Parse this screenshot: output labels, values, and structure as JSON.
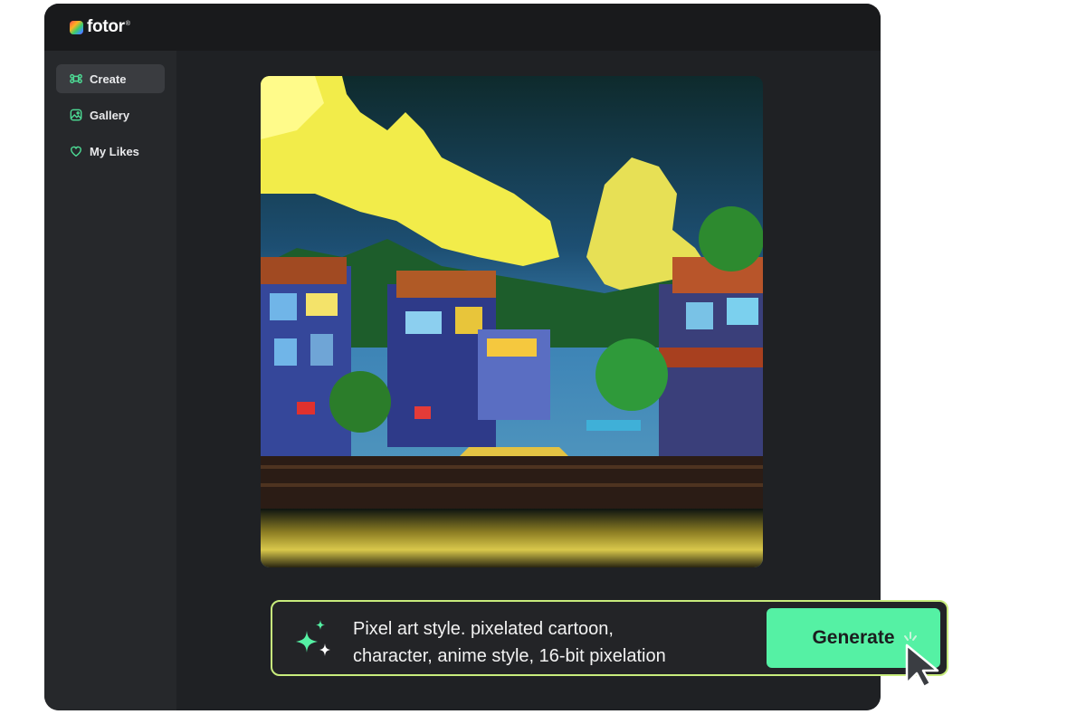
{
  "brand": {
    "name": "fotor",
    "mark": "®"
  },
  "sidebar": {
    "items": [
      {
        "label": "Create",
        "icon": "command-icon",
        "active": true
      },
      {
        "label": "Gallery",
        "icon": "image-icon",
        "active": false
      },
      {
        "label": "My Likes",
        "icon": "heart-icon",
        "active": false
      }
    ]
  },
  "prompt": {
    "line1": "Pixel art style. pixelated cartoon,",
    "line2": "character, anime style, 16-bit pixelation",
    "icon": "sparkle-icon"
  },
  "generate_button": {
    "label": "Generate"
  },
  "colors": {
    "accent_green": "#55f1a4",
    "prompt_border": "#c8ec7c",
    "sidebar_icon": "#4ddc95"
  }
}
